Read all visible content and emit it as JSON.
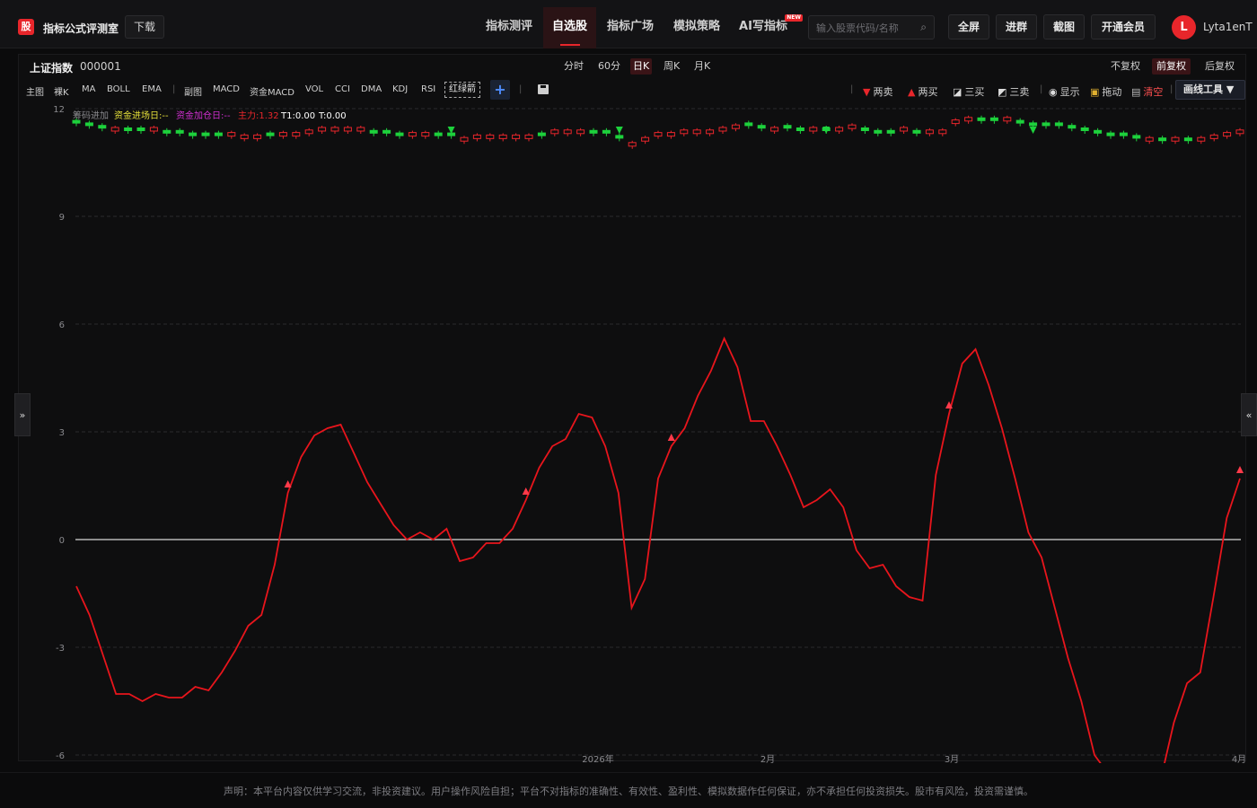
{
  "app": {
    "logo_char": "股",
    "title": "指标公式评测室",
    "download_label": "下载"
  },
  "nav": {
    "items": [
      {
        "label": "指标测评",
        "active": false
      },
      {
        "label": "自选股",
        "active": true
      },
      {
        "label": "指标广场",
        "active": false
      },
      {
        "label": "模拟策略",
        "active": false
      },
      {
        "label": "AI写指标",
        "active": false,
        "tag": "NEW"
      }
    ]
  },
  "search": {
    "placeholder": "输入股票代码/名称",
    "value": ""
  },
  "top_buttons": {
    "fullscreen": "全屏",
    "join_group": "进群",
    "screenshot": "截图",
    "membership": "开通会员"
  },
  "user": {
    "avatar_letter": "L",
    "name": "Lyta1enT"
  },
  "stock": {
    "name": "上证指数",
    "code": "000001"
  },
  "periods": [
    {
      "label": "分时",
      "active": false
    },
    {
      "label": "60分",
      "active": false
    },
    {
      "label": "日K",
      "active": true
    },
    {
      "label": "周K",
      "active": false
    },
    {
      "label": "月K",
      "active": false
    }
  ],
  "adjustments": [
    {
      "label": "不复权",
      "active": false
    },
    {
      "label": "前复权",
      "active": true
    },
    {
      "label": "后复权",
      "active": false
    }
  ],
  "indicators": {
    "main_label": "主图",
    "main": [
      "裸K",
      "MA",
      "BOLL",
      "EMA"
    ],
    "sub_label": "副图",
    "sub": [
      "MACD",
      "资金MACD",
      "VOL",
      "CCI",
      "DMA",
      "KDJ",
      "RSI"
    ],
    "selected": "红绿箭",
    "add": "+"
  },
  "tools": {
    "two_sell": "两卖",
    "two_buy": "两买",
    "three_buy": "三买",
    "three_sell": "三卖",
    "show": "显示",
    "drag": "拖动",
    "clear": "清空",
    "draw_tools": "画线工具 ▼"
  },
  "colors": {
    "accent": "#e8262b",
    "up": "#e8262b",
    "down": "#1dd13c",
    "bg": "#0e0e0f"
  },
  "chart_data": {
    "type": "line",
    "legend": {
      "chip_label": "筹码进加",
      "fund_entry": "资金进场日:--",
      "fund_add": "资金加仓日:--",
      "main_force": "主力:1.32",
      "t1": "T1:0.00",
      "t0": "T:0.00"
    },
    "ylim": [
      -6,
      12
    ],
    "y_ticks": [
      12,
      9,
      6,
      3,
      0,
      -3,
      -6
    ],
    "x_tick_labels": [
      "2026年",
      "2月",
      "3月",
      "4月"
    ],
    "candles": {
      "note_scale": "plotted on upper band near value ~11",
      "values": [
        11.4,
        11.3,
        11.2,
        11.1,
        11.1,
        11.1,
        11.1,
        11.0,
        11.0,
        10.9,
        10.9,
        10.9,
        10.9,
        10.8,
        10.8,
        10.9,
        10.9,
        10.9,
        11.0,
        11.1,
        11.1,
        11.1,
        11.1,
        11.0,
        11.0,
        10.9,
        10.9,
        10.9,
        10.9,
        10.9,
        10.7,
        10.8,
        10.8,
        10.8,
        10.8,
        10.8,
        10.9,
        11.0,
        11.0,
        11.0,
        11.0,
        11.0,
        10.8,
        10.5,
        10.7,
        10.9,
        10.9,
        11.0,
        11.0,
        11.0,
        11.1,
        11.2,
        11.3,
        11.2,
        11.1,
        11.2,
        11.1,
        11.1,
        11.1,
        11.1,
        11.2,
        11.1,
        11.0,
        11.0,
        11.1,
        11.0,
        11.0,
        11.0,
        11.4,
        11.5,
        11.5,
        11.5,
        11.5,
        11.4,
        11.3,
        11.3,
        11.3,
        11.2,
        11.1,
        11.0,
        10.9,
        10.9,
        10.8,
        10.7,
        10.7,
        10.7,
        10.7,
        10.7,
        10.8,
        10.9,
        11.0
      ],
      "up": [
        false,
        false,
        false,
        true,
        false,
        false,
        true,
        false,
        false,
        false,
        false,
        false,
        true,
        true,
        true,
        false,
        true,
        true,
        true,
        true,
        true,
        true,
        true,
        false,
        false,
        false,
        true,
        true,
        false,
        false,
        true,
        true,
        true,
        true,
        true,
        true,
        false,
        true,
        true,
        true,
        false,
        false,
        false,
        true,
        true,
        true,
        true,
        true,
        true,
        true,
        true,
        true,
        false,
        false,
        true,
        false,
        false,
        true,
        false,
        true,
        true,
        false,
        false,
        false,
        true,
        false,
        true,
        true,
        true,
        true,
        false,
        false,
        true,
        false,
        false,
        false,
        false,
        false,
        false,
        false,
        false,
        false,
        false,
        true,
        false,
        true,
        false,
        true,
        true,
        true,
        true
      ]
    },
    "series": [
      {
        "name": "主力",
        "color": "#e8151c",
        "values": [
          -1.3,
          -2.1,
          -3.2,
          -4.3,
          -4.3,
          -4.5,
          -4.3,
          -4.4,
          -4.4,
          -4.1,
          -4.2,
          -3.7,
          -3.1,
          -2.4,
          -2.1,
          -0.7,
          1.3,
          2.3,
          2.9,
          3.1,
          3.2,
          2.4,
          1.6,
          1.0,
          0.4,
          0.0,
          0.2,
          0.0,
          0.3,
          -0.6,
          -0.5,
          -0.1,
          -0.1,
          0.3,
          1.1,
          2.0,
          2.6,
          2.8,
          3.5,
          3.4,
          2.6,
          1.3,
          -1.9,
          -1.1,
          1.7,
          2.6,
          3.1,
          4.0,
          4.7,
          5.6,
          4.8,
          3.3,
          3.3,
          2.6,
          1.8,
          0.9,
          1.1,
          1.4,
          0.9,
          -0.3,
          -0.8,
          -0.7,
          -1.3,
          -1.6,
          -1.7,
          1.8,
          3.5,
          4.9,
          5.3,
          4.3,
          3.1,
          1.7,
          0.2,
          -0.5,
          -1.9,
          -3.3,
          -4.5,
          -6.0,
          -6.5,
          -7.0,
          -7.3,
          -7.3,
          -6.7,
          -5.1,
          -4.0,
          -3.7,
          -1.6,
          0.6,
          1.7
        ]
      }
    ],
    "buy_markers": [
      16,
      34,
      45,
      66,
      89
    ],
    "sell_markers": [
      29,
      42,
      58,
      74
    ]
  },
  "footer": "声明：本平台内容仅供学习交流，非投资建议。用户操作风险自担；平台不对指标的准确性、有效性、盈利性、模拟数据作任何保证，亦不承担任何投资损失。股市有风险，投资需谨慎。"
}
